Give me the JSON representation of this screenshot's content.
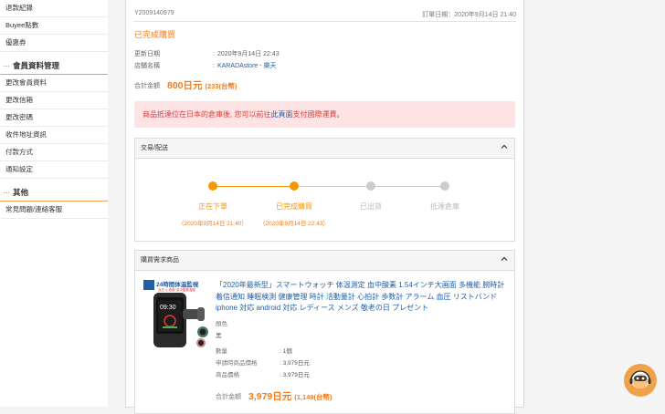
{
  "sidebar": {
    "items_top": [
      "退款紀錄",
      "Buyee點數",
      "優惠券"
    ],
    "member_section": {
      "title": "會員資料管理",
      "items": [
        "更改會員資料",
        "更改信箱",
        "更改密碼",
        "收件地址資訊",
        "付款方式",
        "通知設定"
      ]
    },
    "other_section": {
      "title": "其他",
      "items": [
        "常見問題/連絡客服"
      ]
    }
  },
  "order": {
    "id": "Y2009140979",
    "date_label": "訂單日期",
    "date_value": "2020年9月14日 21:40",
    "status": "已完成購買",
    "update_label": "更新日期",
    "update_value": "2020年9月14日 22:43",
    "store_label": "店舗名稱",
    "store_value": "KARADAstore - 樂天",
    "total_label": "合計金額",
    "total_jpy": "800日元",
    "total_twd": "(233(台幣)"
  },
  "notice": {
    "text_before": "商品抵達位在日本的倉庫後, 您可以前往",
    "link": "此頁面",
    "text_after": "支付國際運費。"
  },
  "trade_panel": {
    "title": "交易/配送",
    "steps": [
      {
        "label": "正在下單",
        "date": "（2020年9月14日 21:40）",
        "active": true
      },
      {
        "label": "已完成購買",
        "date": "（2020年9月14日 22:43）",
        "active": true
      },
      {
        "label": "已出貨",
        "date": "",
        "active": false
      },
      {
        "label": "抵達倉庫",
        "date": "",
        "active": false
      }
    ],
    "colors": {
      "active": "#f39800",
      "inactive": "#cccccc",
      "inactive_text": "#bbbbbb"
    }
  },
  "product_panel": {
    "title": "購買需求商品",
    "title_text": "「2020年最新型」スマートウォッチ 体温測定 血中酸素 1.54インチ大画面 多機能 腕時計 着信通知 睡眠検測 健康管理 時計 活動量計 心拍計 歩数計 アラーム 血圧 リストバンド iphone 対応 android 対応 レディース メンズ 敬老の日 プレゼント",
    "image_badge": "24時間体温監視",
    "image_sub": "血圧·心拍数·血中酸素濃度",
    "image_time": "09:30",
    "color_label": "顏色",
    "color_value": "黑",
    "qty_label": "數量",
    "qty_value": "1個",
    "request_price_label": "申請時商品價格",
    "request_price_value": "3,979日元",
    "price_label": "商品價格",
    "price_value": "3,979日元",
    "total_label": "合計金額",
    "total_jpy": "3,979日元",
    "total_twd": "(1,149(台幣)"
  },
  "icons": {
    "chevron": "chevron-up-icon",
    "chat": "chat-support-icon"
  }
}
